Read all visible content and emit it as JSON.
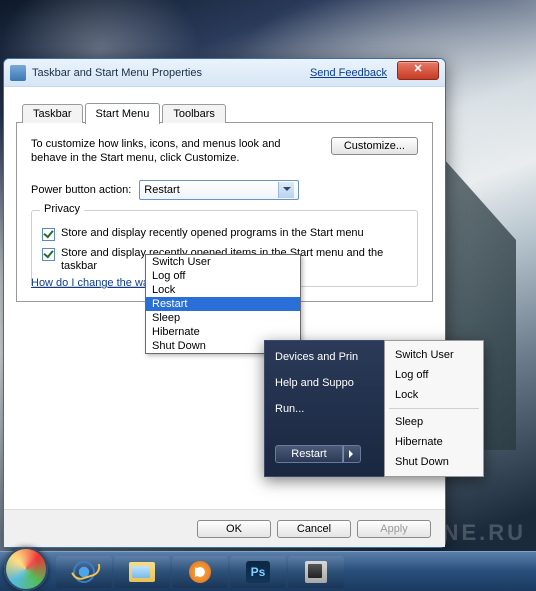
{
  "watermark": "WINLINE.RU",
  "window": {
    "title": "Taskbar and Start Menu Properties",
    "feedback": "Send Feedback",
    "close_glyph": "✕",
    "tabs": {
      "taskbar": "Taskbar",
      "start_menu": "Start Menu",
      "toolbars": "Toolbars"
    },
    "description": "To customize how links, icons, and menus look and behave in the Start menu, click Customize.",
    "customize_btn": "Customize...",
    "power_label": "Power button action:",
    "power_value": "Restart",
    "power_options": [
      "Switch User",
      "Log off",
      "Lock",
      "Restart",
      "Sleep",
      "Hibernate",
      "Shut Down"
    ],
    "privacy_legend": "Privacy",
    "privacy_check1": "Store and display recently opened programs in the Start menu",
    "privacy_check2": "Store and display recently opened items in the Start menu and the taskbar",
    "help_link": "How do I change the way the Start menu looks?",
    "footer": {
      "ok": "OK",
      "cancel": "Cancel",
      "apply": "Apply"
    }
  },
  "start_popup": {
    "items": [
      "Devices and Prin",
      "Help and Suppo",
      "Run..."
    ],
    "power_main": "Restart",
    "submenu": [
      "Switch User",
      "Log off",
      "Lock",
      "Sleep",
      "Hibernate",
      "Shut Down"
    ]
  },
  "taskbar_icons": {
    "ps_label": "Ps"
  }
}
